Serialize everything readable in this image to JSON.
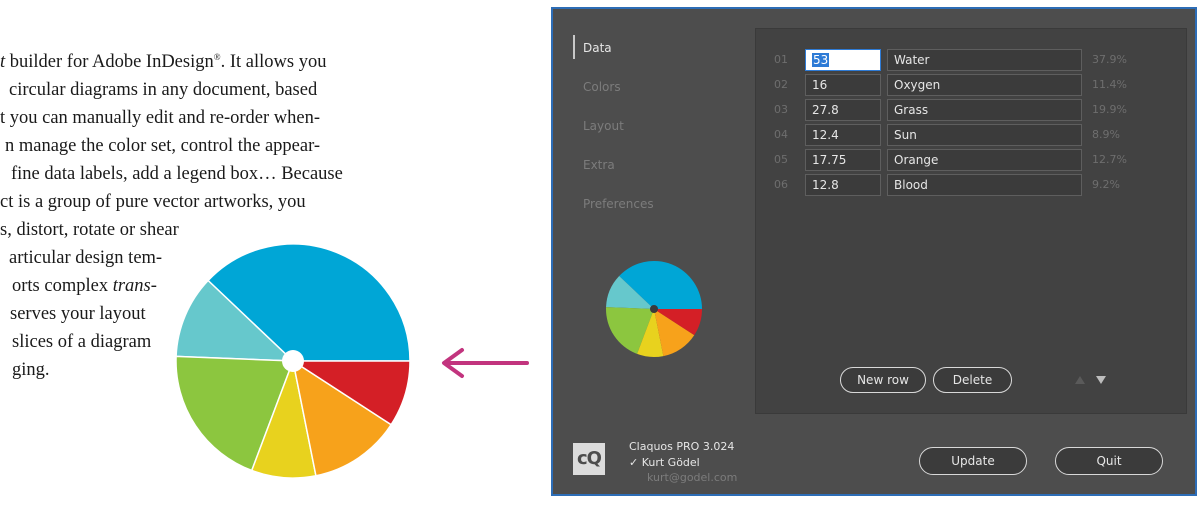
{
  "document": {
    "lines": [
      {
        "pre": "t",
        "text": " builder for Adobe InDesign",
        "sup": "®",
        "post": ". It allows you"
      },
      {
        "text": "circular diagrams in any document, based"
      },
      {
        "text": "t you can manually edit and re-order when-"
      },
      {
        "text": "n manage the color set, control the appear-"
      },
      {
        "text": "fine data labels, add a legend box… Because"
      },
      {
        "text": "ct is a group of pure vector artworks, you"
      },
      {
        "text": "s, distort, rotate or shear"
      },
      {
        "text": "articular design tem-"
      },
      {
        "pre_plain": "orts complex ",
        "italic": "trans-"
      },
      {
        "text": "serves your layout"
      },
      {
        "text": "slices of a diagram"
      },
      {
        "text": "ging."
      }
    ]
  },
  "dialog": {
    "tabs": [
      {
        "label": "Data",
        "active": true
      },
      {
        "label": "Colors",
        "active": false
      },
      {
        "label": "Layout",
        "active": false
      },
      {
        "label": "Extra",
        "active": false
      },
      {
        "label": "Preferences",
        "active": false
      }
    ],
    "rows": [
      {
        "num": "01",
        "value": "53",
        "name": "Water",
        "pct": "37.9%",
        "color": "#00a6d6"
      },
      {
        "num": "02",
        "value": "16",
        "name": "Oxygen",
        "pct": "11.4%",
        "color": "#66c8cc"
      },
      {
        "num": "03",
        "value": "27.8",
        "name": "Grass",
        "pct": "19.9%",
        "color": "#8cc63f"
      },
      {
        "num": "04",
        "value": "12.4",
        "name": "Sun",
        "pct": "8.9%",
        "color": "#e8d21e"
      },
      {
        "num": "05",
        "value": "17.75",
        "name": "Orange",
        "pct": "12.7%",
        "color": "#f7a21b"
      },
      {
        "num": "06",
        "value": "12.8",
        "name": "Blood",
        "pct": "9.2%",
        "color": "#d41f26"
      }
    ],
    "buttons": {
      "new_row": "New row",
      "delete": "Delete",
      "update": "Update",
      "quit": "Quit"
    },
    "footer": {
      "logo": "cQ",
      "product": "Claquos PRO 3.024",
      "user": "✓ Kurt Gödel",
      "email": "kurt@godel.com"
    },
    "colors": {
      "accent": "#2d6db6",
      "arrow": "#c2347e"
    },
    "icons": {
      "move_up": "triangle-up-icon",
      "move_down": "triangle-down-icon",
      "arrow": "arrow-left-icon"
    }
  }
}
